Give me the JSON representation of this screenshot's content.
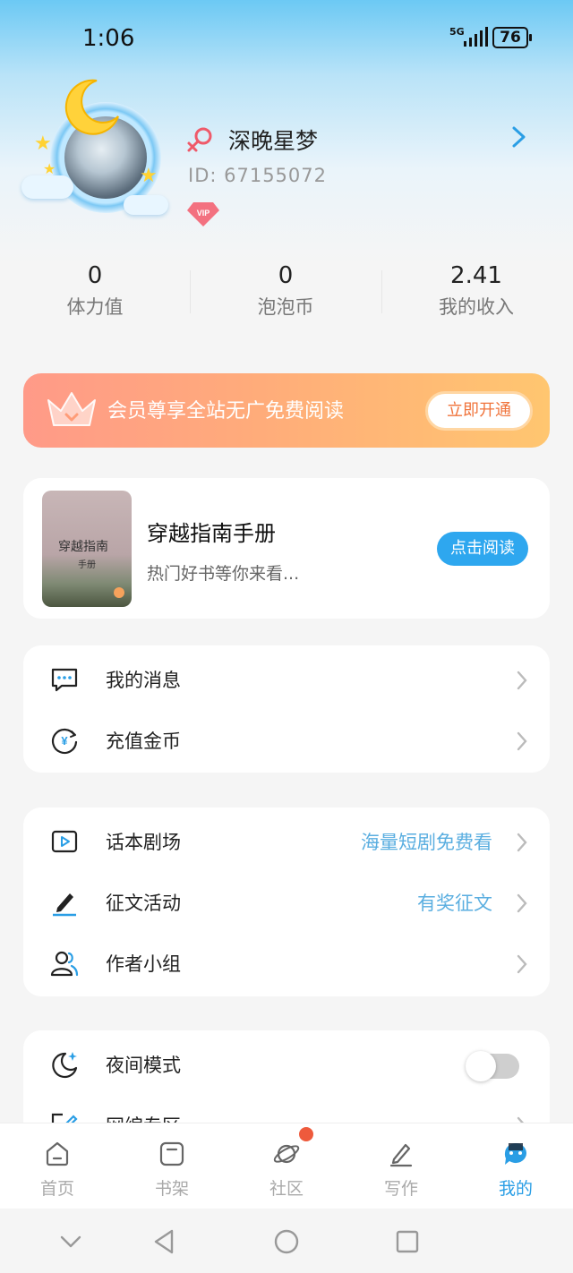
{
  "status_bar": {
    "time": "1:06",
    "network": "5G",
    "battery": "76"
  },
  "profile": {
    "username": "深晚星梦",
    "user_id": "ID:  67155072",
    "vip_badge": "VIP"
  },
  "stats": [
    {
      "value": "0",
      "label": "体力值"
    },
    {
      "value": "0",
      "label": "泡泡币"
    },
    {
      "value": "2.41",
      "label": "我的收入"
    }
  ],
  "vip_banner": {
    "text": "会员尊享全站无广免费阅读",
    "button": "立即开通"
  },
  "book_card": {
    "cover_title": "穿越指南",
    "cover_subtitle": "手册",
    "title": "穿越指南手册",
    "subtitle": "热门好书等你来看...",
    "button": "点击阅读"
  },
  "menu_group_1": [
    {
      "label": "我的消息",
      "icon": "message-icon"
    },
    {
      "label": "充值金币",
      "icon": "coin-icon"
    }
  ],
  "menu_group_2": [
    {
      "label": "话本剧场",
      "extra": "海量短剧免费看",
      "icon": "play-icon"
    },
    {
      "label": "征文活动",
      "extra": "有奖征文",
      "icon": "pen-icon"
    },
    {
      "label": "作者小组",
      "extra": "",
      "icon": "group-icon"
    }
  ],
  "menu_group_3": [
    {
      "label": "夜间模式",
      "icon": "moon-icon",
      "toggle": false
    },
    {
      "label": "网编专区",
      "icon": "edit-icon"
    }
  ],
  "tabbar": [
    {
      "label": "首页",
      "icon": "home-icon",
      "active": false
    },
    {
      "label": "书架",
      "icon": "bookshelf-icon",
      "active": false
    },
    {
      "label": "社区",
      "icon": "planet-icon",
      "active": false,
      "badge": true
    },
    {
      "label": "写作",
      "icon": "write-icon",
      "active": false
    },
    {
      "label": "我的",
      "icon": "profile-chat-icon",
      "active": true
    }
  ],
  "colors": {
    "accent": "#2a9ee5",
    "vip_orange": "#f0743c",
    "highlight_text": "#5aaee0"
  }
}
